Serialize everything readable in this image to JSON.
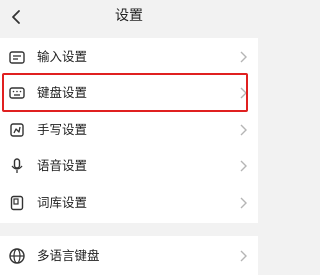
{
  "header": {
    "title": "设置"
  },
  "settings_group": [
    {
      "label": "输入设置",
      "icon": "input-icon"
    },
    {
      "label": "键盘设置",
      "icon": "keyboard-icon",
      "highlighted": true
    },
    {
      "label": "手写设置",
      "icon": "handwriting-icon"
    },
    {
      "label": "语音设置",
      "icon": "microphone-icon"
    },
    {
      "label": "词库设置",
      "icon": "dictionary-icon"
    }
  ],
  "language_group": [
    {
      "label": "多语言键盘",
      "icon": "globe-icon"
    }
  ],
  "colors": {
    "highlight": "#e02020",
    "background": "#f2f2f2",
    "card": "#ffffff"
  }
}
